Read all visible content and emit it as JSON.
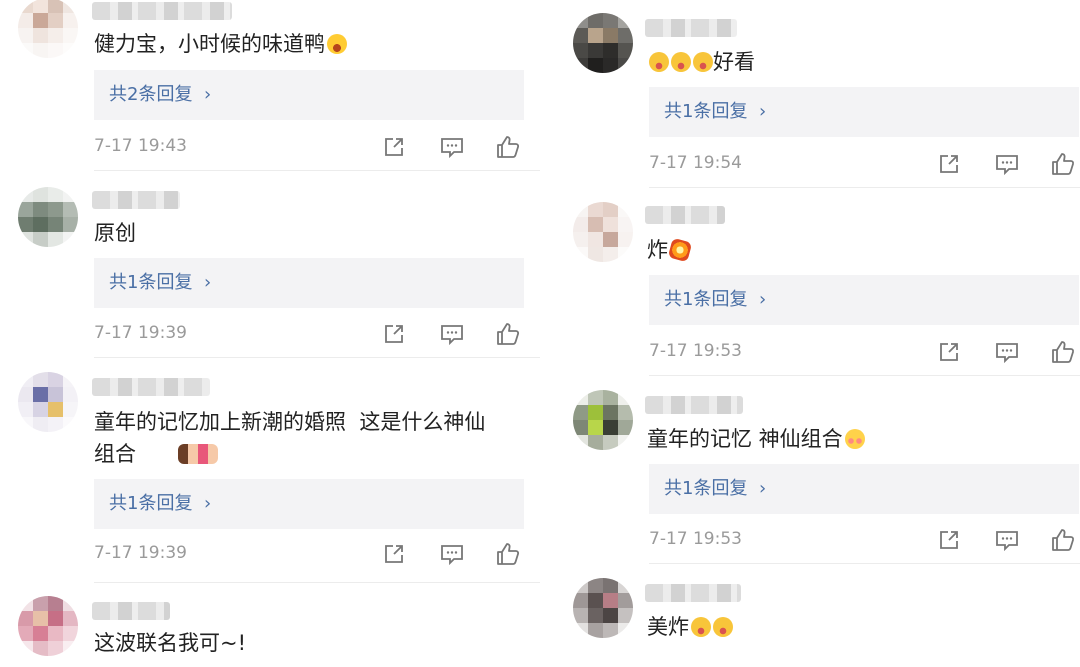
{
  "left": {
    "comments": [
      {
        "text": "健力宝，小时候的味道鸭",
        "emoji": "laughing-emoji",
        "reply": "共2条回复",
        "time": "7-17 19:43"
      },
      {
        "text": "原创",
        "reply": "共1条回复",
        "time": "7-17 19:39"
      },
      {
        "text": "童年的记忆加上新潮的婚照  这是什么神仙",
        "text2": "组合",
        "emoji": "couple-emoji",
        "reply": "共1条回复",
        "time": "7-17 19:39"
      },
      {
        "text": "这波联名我可~!"
      }
    ]
  },
  "right": {
    "comments": [
      {
        "text": "好看",
        "emoji": "crying-emoji",
        "reply": "共1条回复",
        "time": "7-17 19:54"
      },
      {
        "text": "炸",
        "emoji": "explosion-emoji",
        "reply": "共1条回复",
        "time": "7-17 19:53"
      },
      {
        "text": "童年的记忆 神仙组合",
        "emoji": "blushing-emoji",
        "reply": "共1条回复",
        "time": "7-17 19:53"
      },
      {
        "text": "美炸",
        "emoji": "crying-emoji"
      }
    ]
  },
  "chevron": "›",
  "icons": {
    "share": "share-icon",
    "comment": "comment-icon",
    "like": "thumbs-up-icon"
  },
  "colors": {
    "link": "#4a6fa5",
    "meta": "#9a9a9a",
    "reply_bg": "#f3f3f5"
  }
}
